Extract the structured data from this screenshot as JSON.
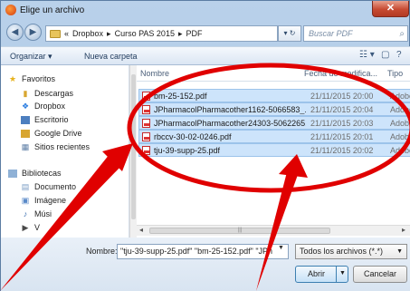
{
  "window": {
    "title": "Elige un archivo",
    "close_label": "✕"
  },
  "address": {
    "prefix": "«",
    "path": [
      "Dropbox",
      "Curso PAS 2015",
      "PDF"
    ],
    "separator": "▸",
    "search_placeholder": "Buscar PDF"
  },
  "toolbar": {
    "organize": "Organizar ▾",
    "new_folder": "Nueva carpeta"
  },
  "sidebar": {
    "favorites": "Favoritos",
    "items": [
      "Descargas",
      "Dropbox",
      "Escritorio",
      "Google Drive",
      "Sitios recientes"
    ],
    "libraries": "Bibliotecas",
    "lib_items": [
      "Documento",
      "Imágene",
      "Músi",
      "V"
    ]
  },
  "columns": {
    "name": "Nombre",
    "date": "Fecha de modifica...",
    "type": "Tipo"
  },
  "files": [
    {
      "name": "bm-25-152.pdf",
      "date": "21/11/2015 20:00",
      "type": "Adobe"
    },
    {
      "name": "JPharmacolPharmacother1162-5066583_...",
      "date": "21/11/2015 20:04",
      "type": "Adobe"
    },
    {
      "name": "JPharmacolPharmacother24303-5062265...",
      "date": "21/11/2015 20:03",
      "type": "Adobe"
    },
    {
      "name": "rbccv-30-02-0246.pdf",
      "date": "21/11/2015 20:01",
      "type": "Adobe"
    },
    {
      "name": "tju-39-supp-25.pdf",
      "date": "21/11/2015 20:02",
      "type": "Adobe"
    }
  ],
  "footer": {
    "name_label": "Nombre:",
    "name_value": "\"tju-39-supp-25.pdf\" \"bm-25-152.pdf\" \"JPh",
    "filter_value": "Todos los archivos (*.*)",
    "open_label": "Abrir",
    "cancel_label": "Cancelar"
  },
  "colors": {
    "annotation": "#e00000",
    "selection": "#cde4fb"
  }
}
